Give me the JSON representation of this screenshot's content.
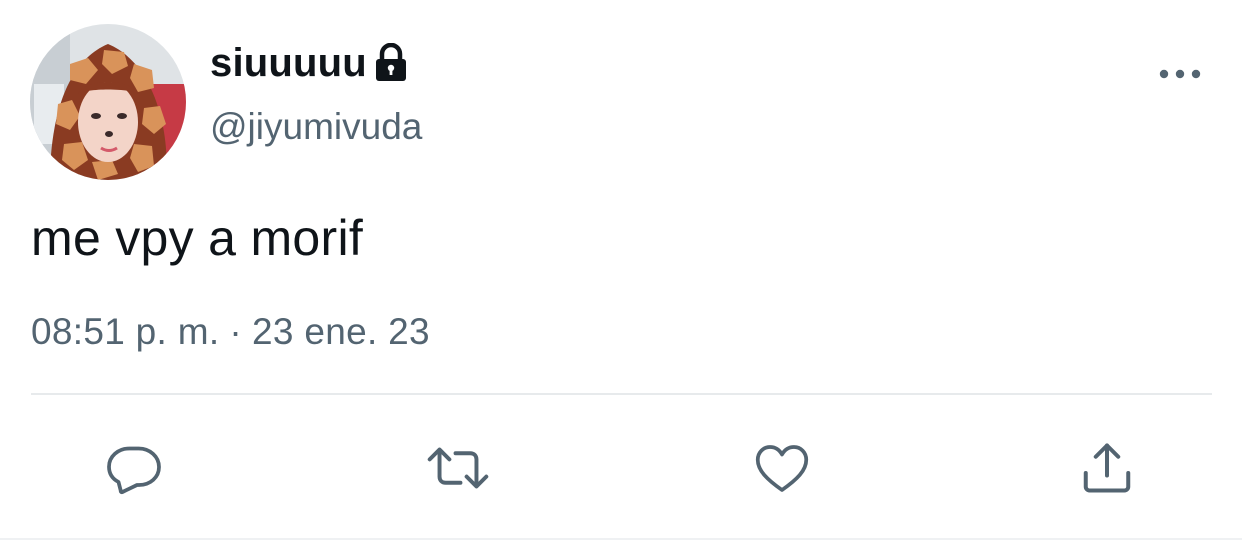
{
  "tweet": {
    "display_name": "siuuuuu",
    "handle": "@jiyumivuda",
    "text": "me vpy a morif",
    "time": "08:51 p. m.",
    "separator": "·",
    "date": "23 ene. 23"
  },
  "icons": {
    "lock": "lock-icon",
    "more": "more-horizontal-icon",
    "reply": "reply-icon",
    "retweet": "retweet-icon",
    "like": "heart-icon",
    "share": "share-icon"
  },
  "colors": {
    "text_primary": "#0f1419",
    "text_secondary": "#536471",
    "icon_gray": "#536471",
    "divider": "#e7eaec"
  }
}
